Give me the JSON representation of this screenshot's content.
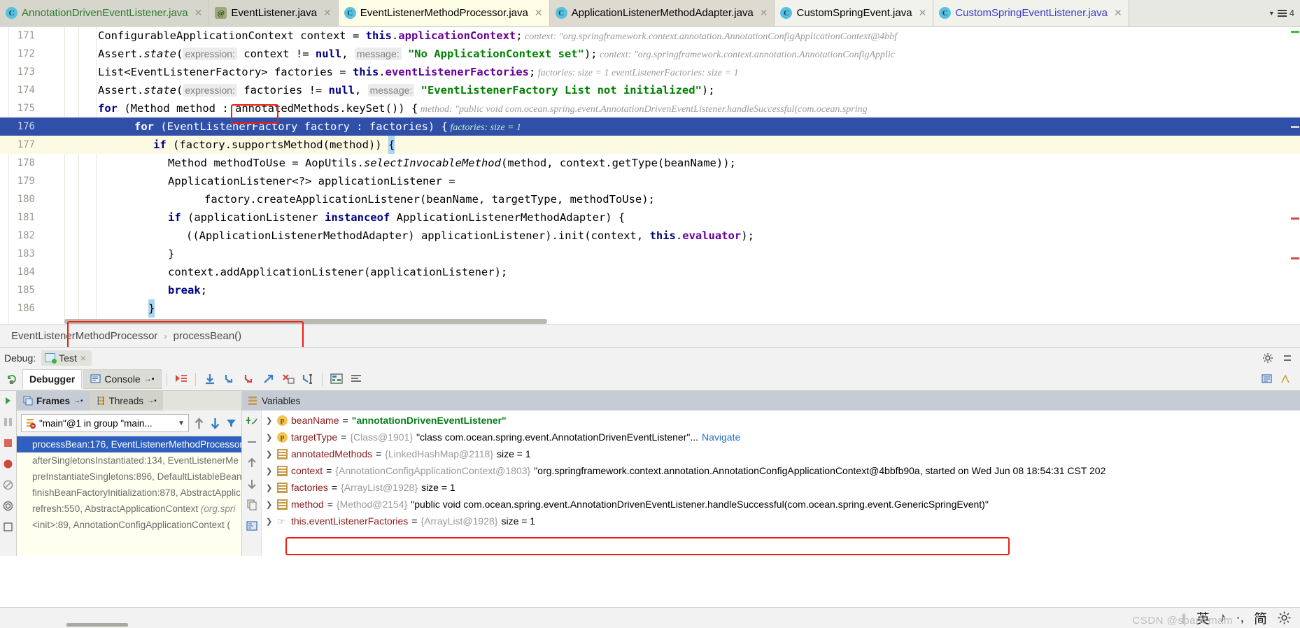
{
  "tabs": [
    {
      "label": "AnnotationDrivenEventListener.java",
      "icon": "class-icon",
      "state": "inactive",
      "text_color": "#2f7a2f"
    },
    {
      "label": "EventListener.java",
      "icon": "annotation-icon",
      "state": "inactive",
      "text_color": "#1f1f1f"
    },
    {
      "label": "EventListenerMethodProcessor.java",
      "icon": "class-icon",
      "state": "active",
      "text_color": "#1f1f1f"
    },
    {
      "label": "ApplicationListenerMethodAdapter.java",
      "icon": "class-icon",
      "state": "plain",
      "text_color": "#1f1f1f"
    },
    {
      "label": "CustomSpringEvent.java",
      "icon": "class-icon",
      "state": "plain",
      "text_color": "#1f1f1f"
    },
    {
      "label": "CustomSpringEventListener.java",
      "icon": "class-icon",
      "state": "plain",
      "text_color": "#3a3aca"
    }
  ],
  "tabbar_right": {
    "count": "4"
  },
  "editor": {
    "lines": [
      {
        "num": "171",
        "indent": 96,
        "highlight": "none",
        "tokens": [
          {
            "t": "ConfigurableApplicationContext context = ",
            "c": "plain"
          },
          {
            "t": "this",
            "c": "kw"
          },
          {
            "t": ".",
            "c": "plain"
          },
          {
            "t": "applicationContext",
            "c": "fld"
          },
          {
            "t": ";",
            "c": "plain"
          }
        ],
        "inline": "context:  \"org.springframework.context.annotation.AnnotationConfigApplicationContext@4bbf"
      },
      {
        "num": "172",
        "indent": 96,
        "highlight": "none",
        "tokens": [
          {
            "t": "Assert.",
            "c": "plain"
          },
          {
            "t": "state",
            "c": "mth"
          },
          {
            "t": "(",
            "c": "plain"
          },
          {
            "t": "expression:",
            "c": "hint"
          },
          {
            "t": " context != ",
            "c": "plain"
          },
          {
            "t": "null",
            "c": "kw"
          },
          {
            "t": ",  ",
            "c": "plain"
          },
          {
            "t": "message:",
            "c": "hint"
          },
          {
            "t": " ",
            "c": "plain"
          },
          {
            "t": "\"No ApplicationContext set\"",
            "c": "str"
          },
          {
            "t": ");",
            "c": "plain"
          }
        ],
        "inline": "context:  \"org.springframework.context.annotation.AnnotationConfigApplic"
      },
      {
        "num": "173",
        "indent": 96,
        "highlight": "none",
        "tokens": [
          {
            "t": "List<EventListenerFactory> factories = ",
            "c": "plain"
          },
          {
            "t": "this",
            "c": "kw"
          },
          {
            "t": ".",
            "c": "plain"
          },
          {
            "t": "eventListenerFactories",
            "c": "fld"
          },
          {
            "t": ";",
            "c": "plain"
          }
        ],
        "inline": "factories:  size = 1  eventListenerFactories:  size = 1"
      },
      {
        "num": "174",
        "indent": 96,
        "highlight": "none",
        "tokens": [
          {
            "t": "Assert.",
            "c": "plain"
          },
          {
            "t": "state",
            "c": "mth"
          },
          {
            "t": "(",
            "c": "plain"
          },
          {
            "t": "expression:",
            "c": "hint"
          },
          {
            "t": " factories != ",
            "c": "plain"
          },
          {
            "t": "null",
            "c": "kw"
          },
          {
            "t": ",  ",
            "c": "plain"
          },
          {
            "t": "message:",
            "c": "hint"
          },
          {
            "t": " ",
            "c": "plain"
          },
          {
            "t": "\"EventListenerFactory List not initialized\"",
            "c": "str"
          },
          {
            "t": ");",
            "c": "plain"
          }
        ],
        "inline": ""
      },
      {
        "num": "175",
        "indent": 96,
        "highlight": "none",
        "tokens": [
          {
            "t": "for",
            "c": "kw"
          },
          {
            "t": " (Method ",
            "c": "plain"
          },
          {
            "t": "method",
            "c": "plain"
          },
          {
            "t": " : annotatedMethods.keySet()) {",
            "c": "plain"
          }
        ],
        "inline": "method:  \"public void com.ocean.spring.event.AnnotationDrivenEventListener.handleSuccessful(com.ocean.spring"
      },
      {
        "num": "176",
        "indent": 148,
        "highlight": "exec",
        "tokens": [
          {
            "t": "for",
            "c": "kw"
          },
          {
            "t": " (EventListenerFactory factory : factories) {",
            "c": "plain"
          }
        ],
        "inline": "factories:  size = 1"
      },
      {
        "num": "177",
        "indent": 175,
        "highlight": "soft",
        "tokens": [
          {
            "t": "if",
            "c": "kw"
          },
          {
            "t": " (factory.supportsMethod(method)) ",
            "c": "plain"
          },
          {
            "t": "{",
            "c": "caret"
          }
        ],
        "inline": ""
      },
      {
        "num": "178",
        "indent": 196,
        "highlight": "none",
        "tokens": [
          {
            "t": "Method methodToUse = AopUtils.",
            "c": "plain"
          },
          {
            "t": "selectInvocableMethod",
            "c": "mth"
          },
          {
            "t": "(method, context.getType(beanName));",
            "c": "plain"
          }
        ],
        "inline": ""
      },
      {
        "num": "179",
        "indent": 196,
        "highlight": "none",
        "tokens": [
          {
            "t": "ApplicationListener<?> applicationListener =",
            "c": "plain"
          }
        ],
        "inline": ""
      },
      {
        "num": "180",
        "indent": 248,
        "highlight": "none",
        "tokens": [
          {
            "t": "factory.createApplicationListener(beanName, targetType, methodToUse);",
            "c": "plain"
          }
        ],
        "inline": ""
      },
      {
        "num": "181",
        "indent": 196,
        "highlight": "none",
        "tokens": [
          {
            "t": "if",
            "c": "kw"
          },
          {
            "t": " (applicationListener ",
            "c": "plain"
          },
          {
            "t": "instanceof",
            "c": "kw"
          },
          {
            "t": " ApplicationListenerMethodAdapter) {",
            "c": "plain"
          }
        ],
        "inline": ""
      },
      {
        "num": "182",
        "indent": 222,
        "highlight": "none",
        "tokens": [
          {
            "t": "((ApplicationListenerMethodAdapter) applicationListener).init(context, ",
            "c": "plain"
          },
          {
            "t": "this",
            "c": "kw"
          },
          {
            "t": ".",
            "c": "plain"
          },
          {
            "t": "evaluator",
            "c": "fld"
          },
          {
            "t": ");",
            "c": "plain"
          }
        ],
        "inline": ""
      },
      {
        "num": "183",
        "indent": 196,
        "highlight": "none",
        "tokens": [
          {
            "t": "}",
            "c": "plain"
          }
        ],
        "inline": ""
      },
      {
        "num": "184",
        "indent": 196,
        "highlight": "none",
        "tokens": [
          {
            "t": "context.addApplicationListener(applicationListener);",
            "c": "plain"
          }
        ],
        "inline": ""
      },
      {
        "num": "185",
        "indent": 196,
        "highlight": "none",
        "tokens": [
          {
            "t": "break",
            "c": "kw"
          },
          {
            "t": ";",
            "c": "plain"
          }
        ],
        "inline": ""
      },
      {
        "num": "186",
        "indent": 168,
        "highlight": "none",
        "tokens": [
          {
            "t": "}",
            "c": "caret"
          }
        ],
        "inline": ""
      }
    ]
  },
  "breadcrumb": {
    "class": "EventListenerMethodProcessor",
    "separator": "›",
    "method": "processBean()"
  },
  "debug_header": {
    "label": "Debug:",
    "config_name": "Test",
    "close": "×"
  },
  "debug_toolbar": {
    "tabs": [
      {
        "label": "Debugger",
        "selected": true
      },
      {
        "label": "Console",
        "selected": false
      }
    ],
    "buttons": [
      "rerun-icon",
      "show-execution-point-icon",
      "step-over-icon",
      "step-into-icon",
      "force-step-into-icon",
      "step-out-icon",
      "drop-frame-icon",
      "run-to-cursor-icon",
      "evaluate-expression-icon",
      "layout-icon"
    ]
  },
  "frames": {
    "tabs": [
      {
        "label": "Frames",
        "selected": true,
        "icon": "frames-icon"
      },
      {
        "label": "Threads",
        "selected": false,
        "icon": "threads-icon"
      }
    ],
    "thread_selector": "\"main\"@1 in group \"main...",
    "stack": [
      {
        "method": "processBean:176, EventListenerMethodProcessor",
        "pkg": "",
        "selected": true
      },
      {
        "method": "afterSingletonsInstantiated:134, EventListenerMe",
        "pkg": "",
        "selected": false
      },
      {
        "method": "preInstantiateSingletons:896, DefaultListableBean",
        "pkg": "",
        "selected": false
      },
      {
        "method": "finishBeanFactoryInitialization:878, AbstractApplic",
        "pkg": "",
        "selected": false
      },
      {
        "method": "refresh:550, AbstractApplicationContext ",
        "pkg": "(org.spri",
        "selected": false
      },
      {
        "method": "<init>:89, AnnotationConfigApplicationContext (",
        "pkg": "",
        "selected": false
      }
    ]
  },
  "variables": {
    "title": "Variables",
    "rows": [
      {
        "icon": "field-icon",
        "name": "beanName",
        "eq": " = ",
        "value": "\"annotationDrivenEventListener\"",
        "value_kind": "string",
        "ref": "",
        "suffix": "",
        "link": ""
      },
      {
        "icon": "field-icon",
        "name": "targetType",
        "eq": " = ",
        "ref": "{Class@1901}",
        "value": "\"class com.ocean.spring.event.AnnotationDrivenEventListener\"...",
        "value_kind": "text",
        "suffix": "",
        "link": " Navigate"
      },
      {
        "icon": "list-icon",
        "name": "annotatedMethods",
        "eq": " = ",
        "ref": "{LinkedHashMap@2118}",
        "value": "",
        "value_kind": "text",
        "suffix": "size = 1",
        "link": ""
      },
      {
        "icon": "list-icon",
        "name": "context",
        "eq": " = ",
        "ref": "{AnnotationConfigApplicationContext@1803}",
        "value": "\"org.springframework.context.annotation.AnnotationConfigApplicationContext@4bbfb90a, started on Wed Jun 08 18:54:31 CST 202",
        "value_kind": "text",
        "suffix": "",
        "link": ""
      },
      {
        "icon": "list-icon",
        "name": "factories",
        "eq": " = ",
        "ref": "{ArrayList@1928}",
        "value": "",
        "value_kind": "text",
        "suffix": "size = 1",
        "link": ""
      },
      {
        "icon": "list-icon",
        "name": "method",
        "eq": " = ",
        "ref": "{Method@2154}",
        "value": "\"public void com.ocean.spring.event.AnnotationDrivenEventListener.handleSuccessful(com.ocean.spring.event.GenericSpringEvent)\"",
        "value_kind": "text",
        "suffix": "",
        "link": "",
        "highlighted": true
      },
      {
        "icon": "watch-icon",
        "name": "this.eventListenerFactories",
        "eq": " = ",
        "ref": "{ArrayList@1928}",
        "value": "",
        "value_kind": "text",
        "suffix": "size = 1",
        "link": ""
      }
    ]
  },
  "statusbar": {
    "ime": [
      "英",
      "♪",
      "·,",
      "简"
    ],
    "gear": "settings-icon",
    "watermark": "CSDN @spark mam"
  },
  "colors": {
    "exec_line": "#2f4fa8",
    "soft_line": "#fdfae4",
    "selection": "#2f5fc0",
    "red_annotation": "#f01e0e",
    "tab_active": "#fdfde6"
  }
}
